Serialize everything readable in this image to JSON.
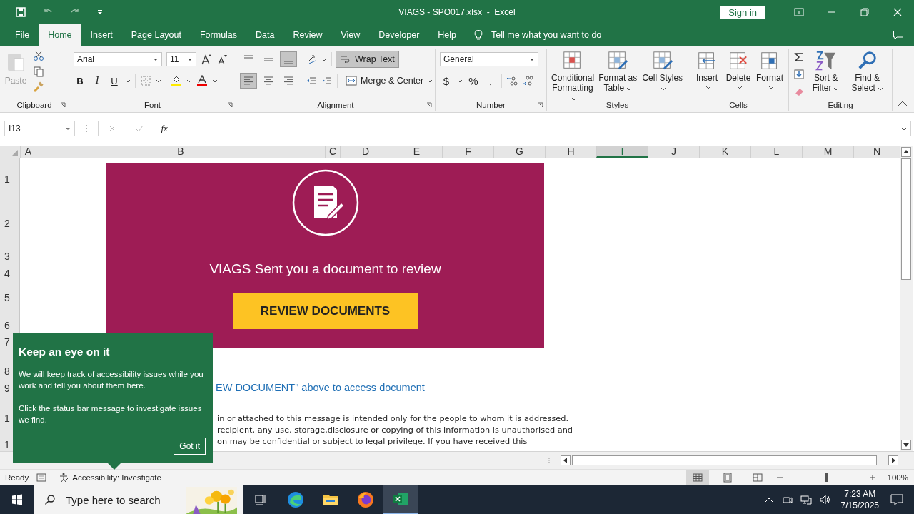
{
  "title_bar": {
    "title": "VIAGS - SPO017.xlsx  -  Excel",
    "sign_in": "Sign in"
  },
  "ribbon_tabs": [
    {
      "label": "File",
      "selected": false
    },
    {
      "label": "Home",
      "selected": true
    },
    {
      "label": "Insert",
      "selected": false
    },
    {
      "label": "Page Layout",
      "selected": false
    },
    {
      "label": "Formulas",
      "selected": false
    },
    {
      "label": "Data",
      "selected": false
    },
    {
      "label": "Review",
      "selected": false
    },
    {
      "label": "View",
      "selected": false
    },
    {
      "label": "Developer",
      "selected": false
    },
    {
      "label": "Help",
      "selected": false
    }
  ],
  "tell_me": {
    "placeholder": "Tell me what you want to do"
  },
  "ribbon": {
    "clipboard": {
      "label": "Clipboard",
      "paste": "Paste",
      "paste_disabled": true
    },
    "font": {
      "label": "Font",
      "family": "Arial",
      "size": "11",
      "bold": "B",
      "italic": "I",
      "underline": "U"
    },
    "alignment": {
      "label": "Alignment",
      "vertical": [
        {
          "kind": "top",
          "selected": false
        },
        {
          "kind": "middle",
          "selected": false
        },
        {
          "kind": "bottom",
          "selected": true
        }
      ],
      "horizontal": [
        {
          "kind": "left",
          "selected": true
        },
        {
          "kind": "center",
          "selected": false
        },
        {
          "kind": "right",
          "selected": false
        }
      ],
      "wrap_text": {
        "label": "Wrap Text",
        "selected": true
      },
      "merge_center": "Merge & Center"
    },
    "number": {
      "label": "Number",
      "format": "General",
      "currency": "$",
      "percent": "%",
      "comma": ","
    },
    "styles": {
      "label": "Styles",
      "buttons": [
        "Conditional Formatting",
        "Format as Table",
        "Cell Styles"
      ]
    },
    "cells": {
      "label": "Cells",
      "buttons": [
        "Insert",
        "Delete",
        "Format"
      ]
    },
    "editing": {
      "label": "Editing",
      "buttons": [
        "Sort & Filter",
        "Find & Select"
      ]
    }
  },
  "formula_bar": {
    "name_box": "I13",
    "function_label": "fx"
  },
  "columns": [
    {
      "label": "A",
      "selected": false
    },
    {
      "label": "B",
      "selected": false
    },
    {
      "label": "C",
      "selected": false
    },
    {
      "label": "D",
      "selected": false
    },
    {
      "label": "E",
      "selected": false
    },
    {
      "label": "F",
      "selected": false
    },
    {
      "label": "G",
      "selected": false
    },
    {
      "label": "H",
      "selected": false
    },
    {
      "label": "I",
      "selected": true
    },
    {
      "label": "J",
      "selected": false
    },
    {
      "label": "K",
      "selected": false
    },
    {
      "label": "L",
      "selected": false
    },
    {
      "label": "M",
      "selected": false
    },
    {
      "label": "N",
      "selected": false
    }
  ],
  "rows": [
    "1",
    "2",
    "3",
    "4",
    "5",
    "6",
    "7",
    "8",
    "9",
    "1",
    "1"
  ],
  "sheet": {
    "banner": {
      "title": "VIAGS Sent you a document to review",
      "button": "REVIEW DOCUMENTS"
    },
    "link_text": "EW DOCUMENT\" above to access document",
    "disclaimer": [
      "in or attached to this message is intended only for the people to whom it is addressed.",
      "recipient, any use, storage,disclosure or copying of this information is unauthorised and",
      "on may be confidential or subject to legal privilege. If you have received this"
    ]
  },
  "tooltip": {
    "title": "Keep an eye on it",
    "paragraphs": [
      "We will keep track of accessibility issues while you work and tell you about them here.",
      "Click the status bar message to investigate issues we find."
    ],
    "button": "Got it"
  },
  "status_bar": {
    "ready": "Ready",
    "accessibility": "Accessibility: Investigate",
    "zoom": "100%",
    "zoom_slider": {
      "level": 0.5
    }
  },
  "taskbar": {
    "search_placeholder": "Type here to search",
    "apps": [
      {
        "kind": "taskview",
        "selected": false
      },
      {
        "kind": "edge",
        "selected": false
      },
      {
        "kind": "folder",
        "selected": false
      },
      {
        "kind": "firefox",
        "selected": false
      },
      {
        "kind": "excel",
        "selected": true
      }
    ],
    "time": "7:23 AM",
    "date": "7/15/2025"
  }
}
